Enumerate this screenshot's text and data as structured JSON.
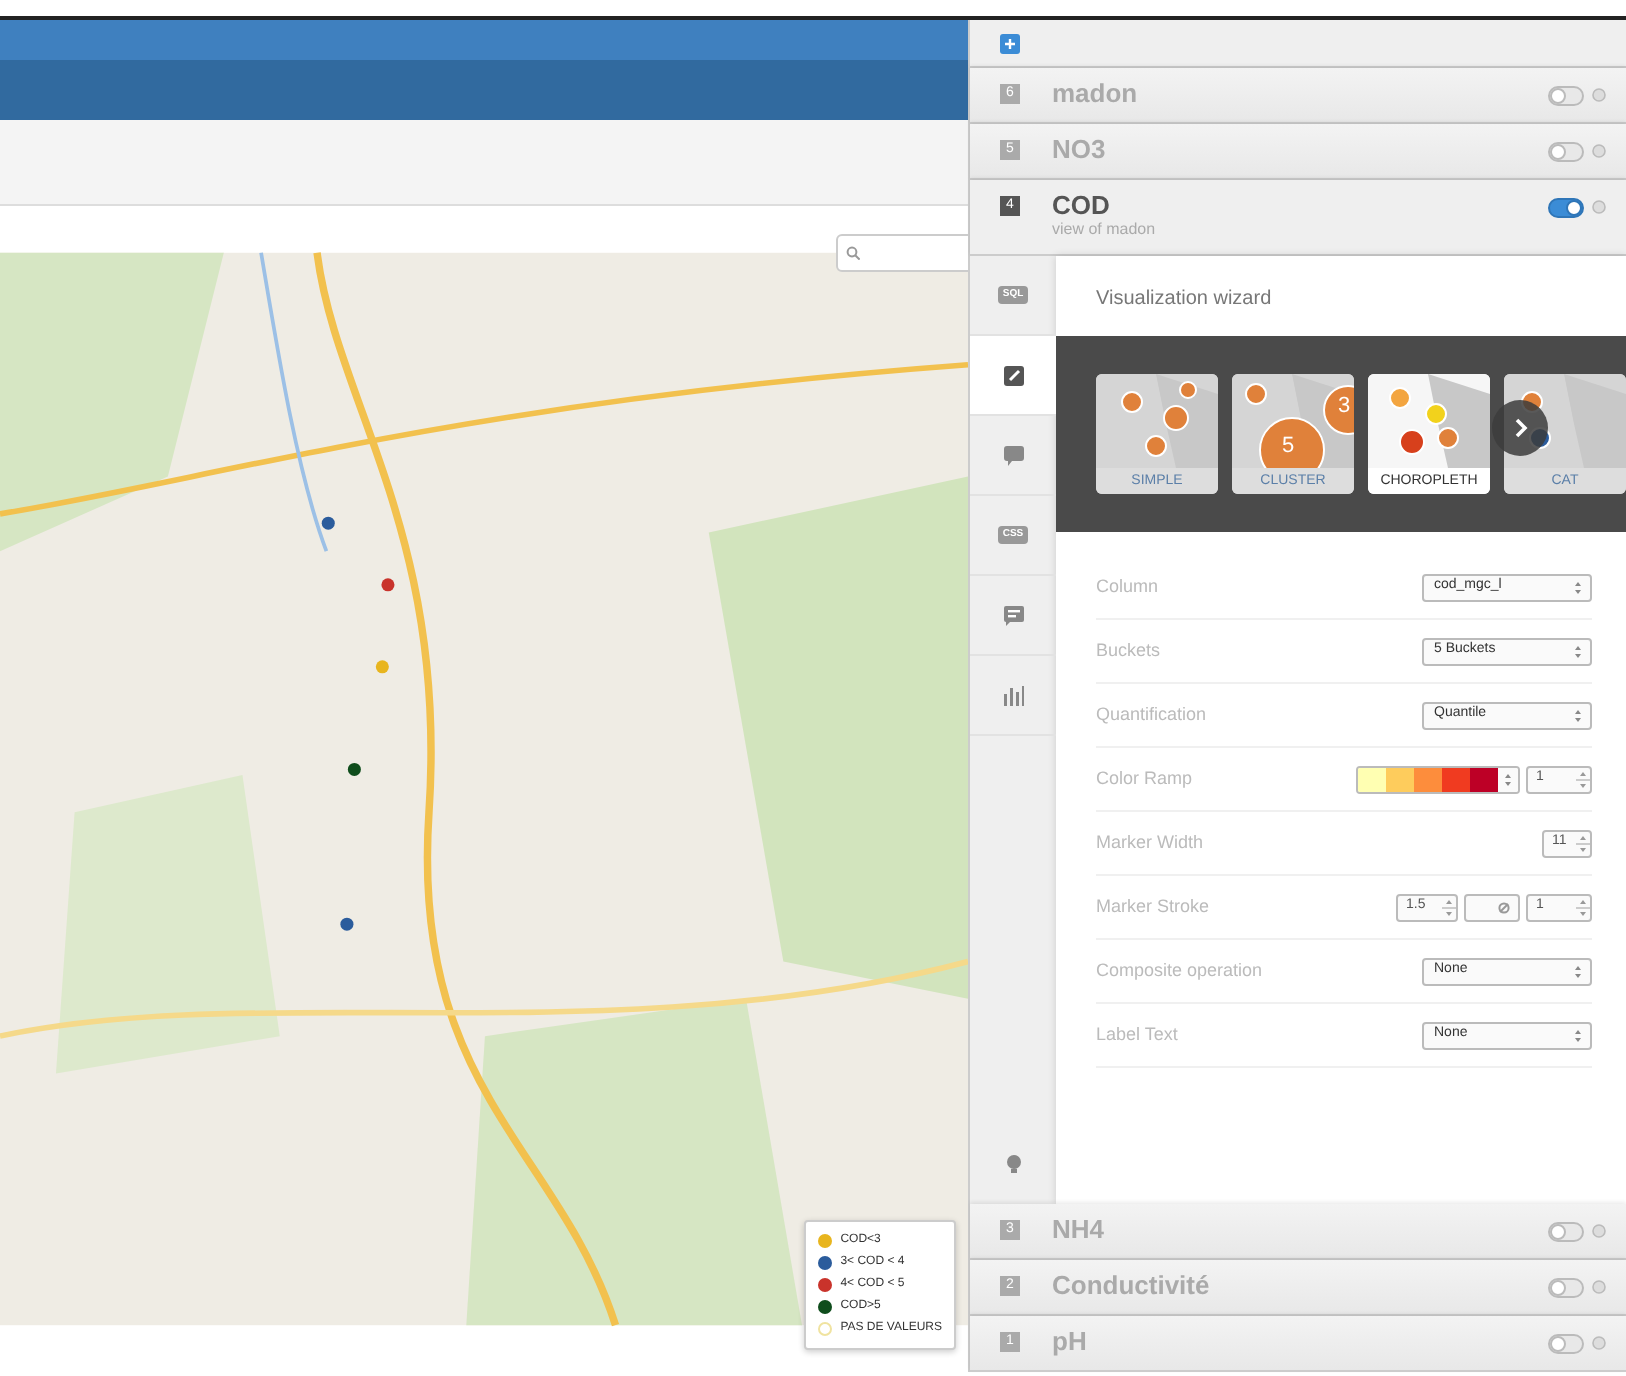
{
  "map": {
    "legend": [
      {
        "label": "COD<3",
        "color": "#e8b51e",
        "kind": "dot"
      },
      {
        "label": "3< COD < 4",
        "color": "#2b5c9c",
        "kind": "dot"
      },
      {
        "label": "4< COD < 5",
        "color": "#c9332b",
        "kind": "dot"
      },
      {
        "label": "COD>5",
        "color": "#0f4d1c",
        "kind": "dot"
      },
      {
        "label": "PAS DE VALEURS",
        "color": "#f0e3a0",
        "kind": "ring"
      }
    ]
  },
  "layers_top": [
    {
      "number": "6",
      "name": "madon",
      "on": false,
      "selected": false
    },
    {
      "number": "5",
      "name": "NO3",
      "on": false,
      "selected": false
    },
    {
      "number": "4",
      "name": "COD",
      "subtitle": "view of madon",
      "on": true,
      "selected": true
    }
  ],
  "rail": [
    {
      "kind": "sql",
      "label": "SQL",
      "selected": false
    },
    {
      "kind": "wizard",
      "selected": true
    },
    {
      "kind": "infowindow",
      "selected": false
    },
    {
      "kind": "css",
      "label": "CSS",
      "selected": false
    },
    {
      "kind": "legend",
      "selected": false
    },
    {
      "kind": "chart",
      "selected": false
    }
  ],
  "rail_bottom": {
    "kind": "bulb"
  },
  "wizard": {
    "title": "Visualization wizard",
    "types": [
      {
        "label": "SIMPLE",
        "kind": "simple",
        "selected": false
      },
      {
        "label": "CLUSTER",
        "kind": "cluster",
        "number": "5",
        "number2": "3",
        "selected": false
      },
      {
        "label": "CHOROPLETH",
        "kind": "choropleth",
        "selected": true
      },
      {
        "label": "CAT",
        "kind": "category",
        "selected": false
      }
    ],
    "fields": [
      {
        "kind": "select",
        "label": "Column",
        "value": "cod_mgc_l"
      },
      {
        "kind": "select",
        "label": "Buckets",
        "value": "5 Buckets"
      },
      {
        "kind": "select",
        "label": "Quantification",
        "value": "Quantile"
      },
      {
        "kind": "ramp",
        "label": "Color Ramp",
        "swatches": [
          {
            "color": "#ffffb2"
          },
          {
            "color": "#fecc5c"
          },
          {
            "color": "#fd8d3c"
          },
          {
            "color": "#f03b20"
          },
          {
            "color": "#bd0026"
          }
        ],
        "value": "1"
      },
      {
        "kind": "number",
        "label": "Marker Width",
        "value": "11"
      },
      {
        "kind": "stroke",
        "label": "Marker Stroke",
        "value": "1.5",
        "opacity": "1"
      },
      {
        "kind": "select",
        "label": "Composite operation",
        "value": "None"
      },
      {
        "kind": "select",
        "label": "Label Text",
        "value": "None"
      }
    ]
  },
  "layers_bottom": [
    {
      "number": "3",
      "name": "NH4",
      "on": false,
      "selected": false
    },
    {
      "number": "2",
      "name": "Conductivité",
      "on": false,
      "selected": false
    },
    {
      "number": "1",
      "name": "pH",
      "on": false,
      "selected": false
    }
  ]
}
